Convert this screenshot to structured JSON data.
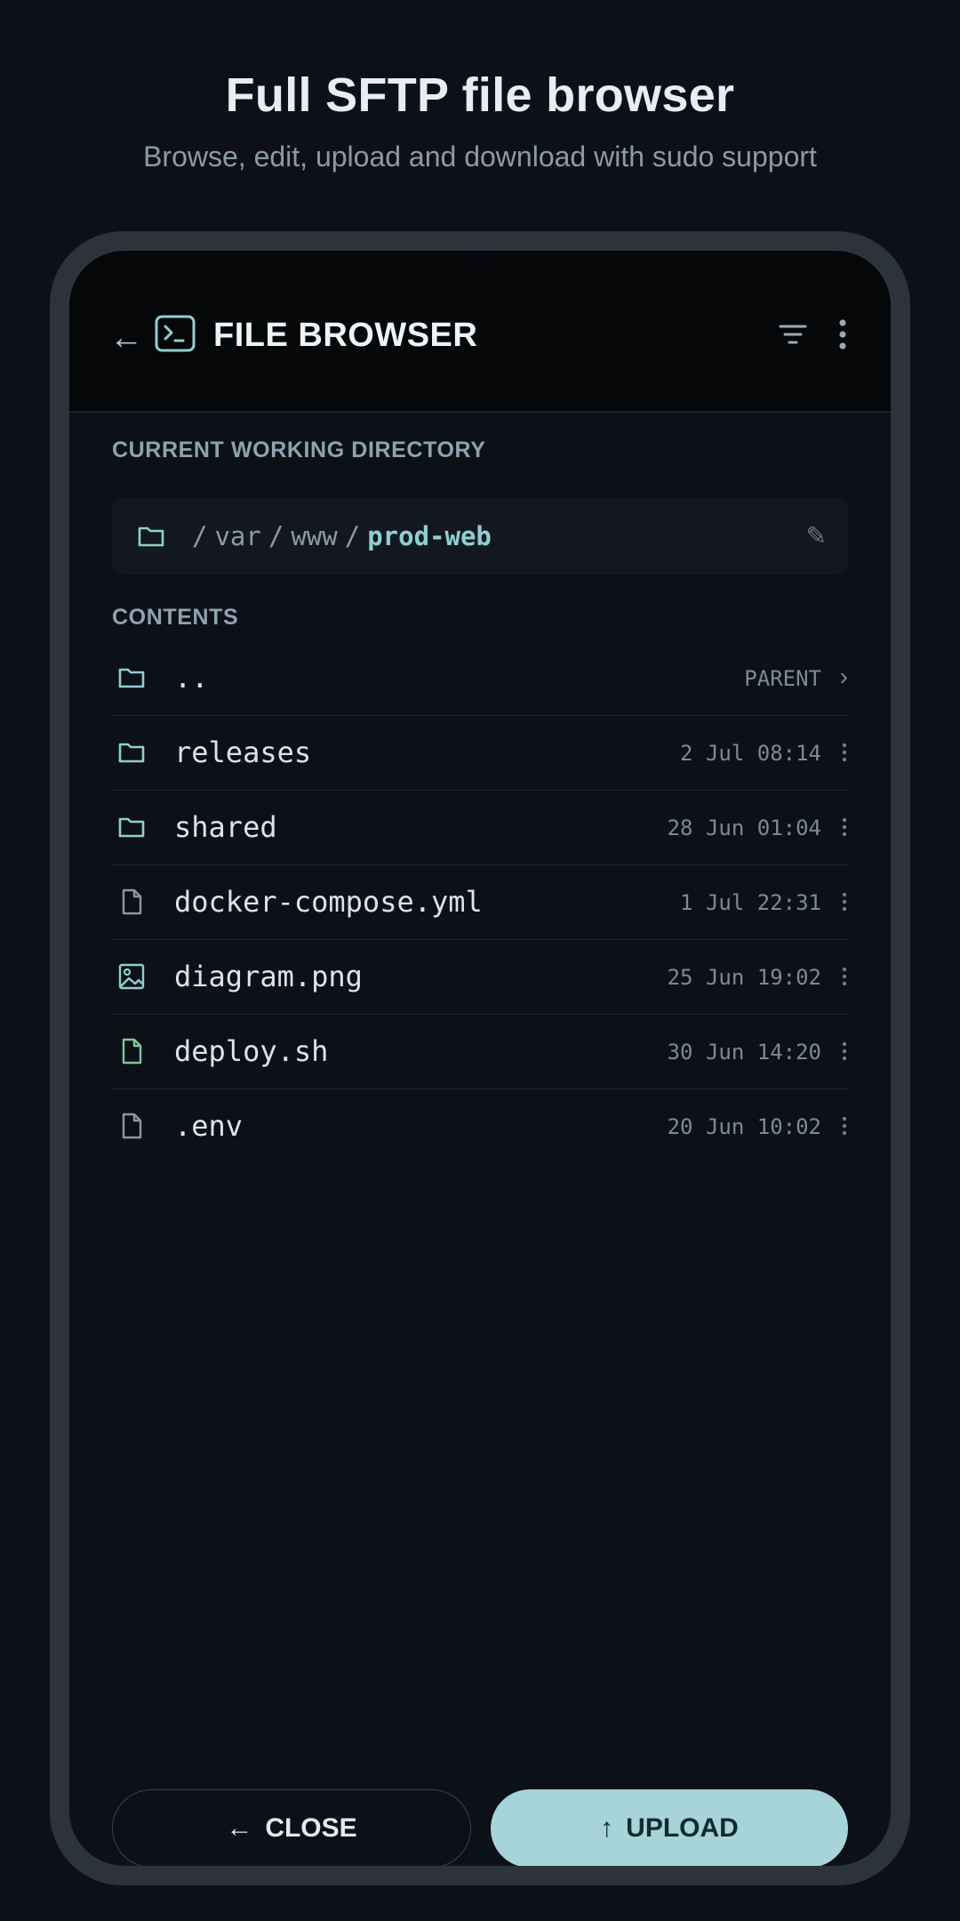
{
  "hero": {
    "title": "Full SFTP file browser",
    "subtitle": "Browse, edit, upload and download with sudo support"
  },
  "appbar": {
    "back_icon": "←",
    "title": "FILE BROWSER",
    "icons": [
      "back-arrow-icon",
      "terminal-icon",
      "filter-icon",
      "more-vert-icon"
    ]
  },
  "cwd": {
    "label": "CURRENT WORKING DIRECTORY",
    "separator": "/",
    "segments": [
      "var",
      "www"
    ],
    "current": "prod-web",
    "edit_icon": "✎"
  },
  "contents": {
    "label": "CONTENTS",
    "parent": {
      "name": "..",
      "meta": "PARENT",
      "chevron": "›"
    },
    "files": [
      {
        "name": "releases",
        "date": "2 Jul 08:14",
        "icon": "folder-icon"
      },
      {
        "name": "shared",
        "date": "28 Jun 01:04",
        "icon": "folder-icon"
      },
      {
        "name": "docker-compose.yml",
        "date": "1 Jul 22:31",
        "icon": "file-icon"
      },
      {
        "name": "diagram.png",
        "date": "25 Jun 19:02",
        "icon": "image-file-icon"
      },
      {
        "name": "deploy.sh",
        "date": "30 Jun 14:20",
        "icon": "script-file-icon"
      },
      {
        "name": ".env",
        "date": "20 Jun 10:02",
        "icon": "file-icon"
      }
    ]
  },
  "actions": {
    "close_arrow": "←",
    "close_label": "CLOSE",
    "upload_arrow": "↑",
    "upload_label": "UPLOAD"
  },
  "colors": {
    "background": "#0d1117",
    "accent": "#8fcfd2",
    "upload_button": "#a7d4d8",
    "script_icon": "#7fc99a"
  }
}
